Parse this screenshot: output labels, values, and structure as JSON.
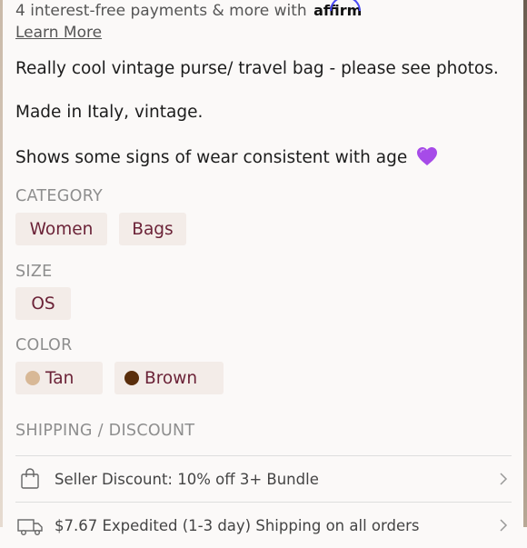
{
  "payments": {
    "text": "4 interest-free payments & more with",
    "brand": "affirm",
    "learn_more": "Learn More"
  },
  "description": {
    "line1": "Really cool vintage purse/ travel bag - please see photos.",
    "line2": "Made in Italy, vintage.",
    "line3": "Shows some signs of wear consistent with age",
    "emoji": "purple-heart-icon"
  },
  "category": {
    "label": "CATEGORY",
    "items": [
      "Women",
      "Bags"
    ]
  },
  "size": {
    "label": "SIZE",
    "value": "OS"
  },
  "color": {
    "label": "COLOR",
    "items": [
      {
        "name": "Tan",
        "hex": "#d8b896"
      },
      {
        "name": "Brown",
        "hex": "#5a2e0c"
      }
    ]
  },
  "shipping": {
    "label": "SHIPPING / DISCOUNT",
    "rows": [
      {
        "icon": "shopping-bag-icon",
        "text": "Seller Discount: 10% off 3+ Bundle"
      },
      {
        "icon": "truck-icon",
        "text": "$7.67 Expedited (1-3 day) Shipping on all orders"
      }
    ]
  },
  "colors": {
    "chip_bg": "#f3ece8",
    "chip_text": "#6b2237",
    "affirm_blue": "#4a4af4"
  }
}
